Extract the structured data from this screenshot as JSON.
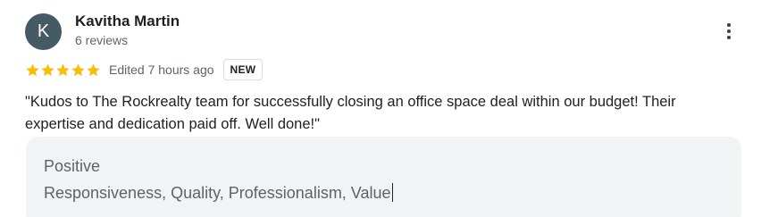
{
  "review": {
    "avatar_letter": "K",
    "avatar_color": "#455a64",
    "author_name": "Kavitha Martin",
    "author_meta": "6 reviews",
    "rating": 5,
    "rating_max": 5,
    "star_color": "#fbbc04",
    "edited": "Edited 7 hours ago",
    "badge": "NEW",
    "text": "\"Kudos to The Rockrealty team for successfully closing an office space deal within our budget! Their expertise and dedication paid off. Well done!\"",
    "more_icon": "more-vertical-icon"
  },
  "highlights": {
    "label": "Positive",
    "value": "Responsiveness, Quality, Professionalism, Value"
  }
}
